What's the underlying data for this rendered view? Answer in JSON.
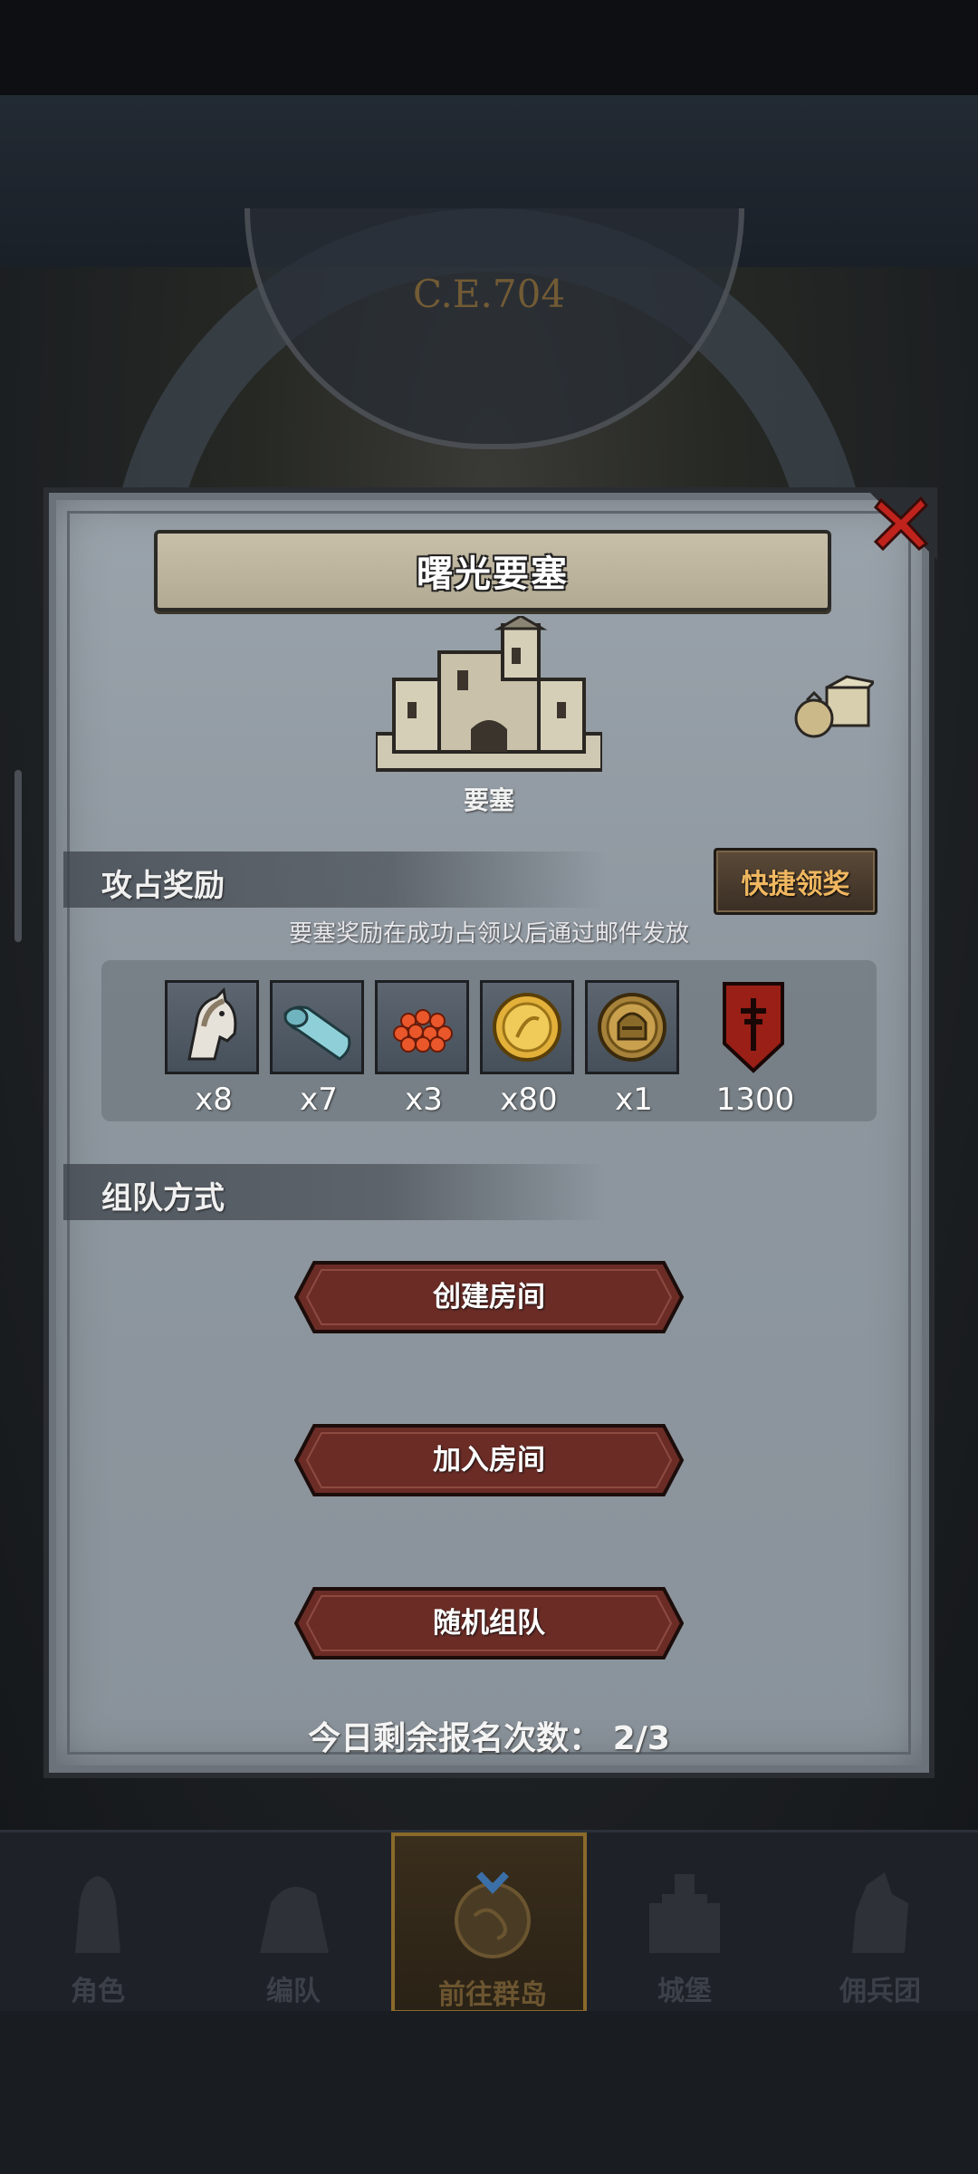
{
  "background": {
    "era_label": "C.E.704"
  },
  "dialog": {
    "title": "曙光要塞",
    "building_label": "要塞",
    "rewards_section": {
      "title": "攻占奖励",
      "quick_claim_label": "快捷领奖",
      "note": "要塞奖励在成功占领以后通过邮件发放",
      "items": [
        {
          "icon": "horse-icon",
          "count": "x8"
        },
        {
          "icon": "cloth-icon",
          "count": "x7"
        },
        {
          "icon": "gems-icon",
          "count": "x3"
        },
        {
          "icon": "gold-coin-icon",
          "count": "x80"
        },
        {
          "icon": "helmet-coin-icon",
          "count": "x1"
        },
        {
          "icon": "banner-icon",
          "count": "1300"
        }
      ]
    },
    "team_section": {
      "title": "组队方式",
      "create_room_label": "创建房间",
      "join_room_label": "加入房间",
      "random_team_label": "随机组队"
    },
    "remaining_label": "今日剩余报名次数：",
    "remaining_value": "2/3"
  },
  "bottom_nav": {
    "items": [
      {
        "label": "角色",
        "icon": "knight-icon"
      },
      {
        "label": "编队",
        "icon": "formation-icon"
      },
      {
        "label": "前往群岛",
        "icon": "globe-icon",
        "active": true
      },
      {
        "label": "城堡",
        "icon": "castle-icon"
      },
      {
        "label": "佣兵团",
        "icon": "mercenary-icon"
      }
    ]
  },
  "colors": {
    "panel": "#8e979f",
    "button_red": "#6b2c26",
    "quick_btn_text": "#f0b760",
    "close_red": "#c0231c"
  }
}
